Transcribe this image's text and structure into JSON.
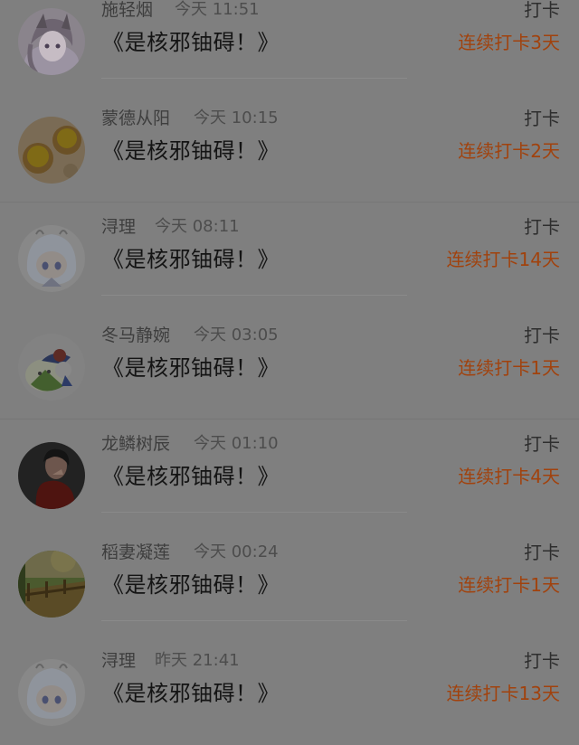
{
  "feed": {
    "items": [
      {
        "username": "施轻烟",
        "time": "今天 11:51",
        "title": "《是核邪铀碍！》",
        "action": "打卡",
        "streak": "连续打卡3天",
        "avatar": "anime-girl-avatar"
      },
      {
        "username": "蒙德从阳",
        "time": "今天 10:15",
        "title": "《是核邪铀碍！》",
        "action": "打卡",
        "streak": "连续打卡2天",
        "avatar": "tart-photo-avatar"
      },
      {
        "username": "浔理",
        "time": "今天 08:11",
        "title": "《是核邪铀碍！》",
        "action": "打卡",
        "streak": "连续打卡14天",
        "avatar": "chibi-girl-avatar"
      },
      {
        "username": "冬马静婉",
        "time": "今天 03:05",
        "title": "《是核邪铀碍！》",
        "action": "打卡",
        "streak": "连续打卡1天",
        "avatar": "cartoon-character-avatar"
      },
      {
        "username": "龙鳞树辰",
        "time": "今天 01:10",
        "title": "《是核邪铀碍！》",
        "action": "打卡",
        "streak": "连续打卡4天",
        "avatar": "portrait-photo-avatar"
      },
      {
        "username": "稻妻凝莲",
        "time": "今天 00:24",
        "title": "《是核邪铀碍！》",
        "action": "打卡",
        "streak": "连续打卡1天",
        "avatar": "landscape-photo-avatar"
      },
      {
        "username": "浔理",
        "time": "昨天 21:41",
        "title": "《是核邪铀碍！》",
        "action": "打卡",
        "streak": "连续打卡13天",
        "avatar": "chibi-girl-avatar"
      }
    ]
  }
}
